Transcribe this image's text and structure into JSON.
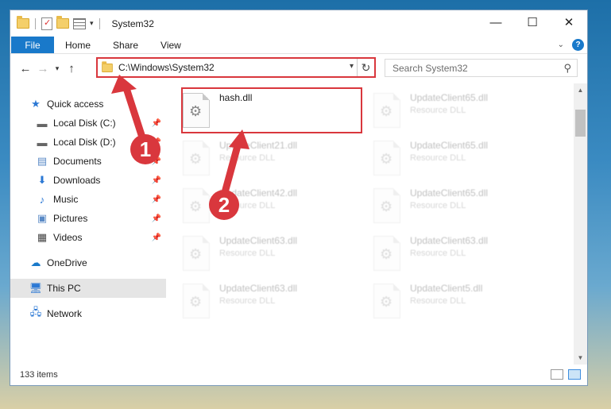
{
  "window": {
    "title": "System32",
    "controls": {
      "minimize": "—",
      "maximize": "☐",
      "close": "✕"
    }
  },
  "ribbon": {
    "file_tab": "File",
    "tabs": [
      "Home",
      "Share",
      "View"
    ]
  },
  "address": {
    "path": "C:\\Windows\\System32"
  },
  "search": {
    "placeholder": "Search System32"
  },
  "sidebar": {
    "quick_access": "Quick access",
    "pinned": [
      {
        "label": "Local Disk (C:)",
        "icon": "drive-icon"
      },
      {
        "label": "Local Disk (D:)",
        "icon": "drive-icon"
      },
      {
        "label": "Documents",
        "icon": "documents-icon"
      },
      {
        "label": "Downloads",
        "icon": "downloads-icon"
      },
      {
        "label": "Music",
        "icon": "music-icon"
      },
      {
        "label": "Pictures",
        "icon": "pictures-icon"
      },
      {
        "label": "Videos",
        "icon": "videos-icon"
      }
    ],
    "onedrive": "OneDrive",
    "this_pc": "This PC",
    "network": "Network"
  },
  "files": [
    {
      "name": "hash.dll",
      "type": "",
      "highlighted": true
    },
    {
      "name": "UpdateClient65.dll",
      "type": "Resource DLL"
    },
    {
      "name": "UpdateClient21.dll",
      "type": "Resource DLL"
    },
    {
      "name": "UpdateClient65.dll",
      "type": "Resource DLL"
    },
    {
      "name": "UpdateClient42.dll",
      "type": "Resource DLL"
    },
    {
      "name": "UpdateClient65.dll",
      "type": "Resource DLL"
    },
    {
      "name": "UpdateClient63.dll",
      "type": "Resource DLL"
    },
    {
      "name": "UpdateClient63.dll",
      "type": "Resource DLL"
    },
    {
      "name": "UpdateClient63.dll",
      "type": "Resource DLL"
    },
    {
      "name": "UpdateClient5.dll",
      "type": "Resource DLL"
    }
  ],
  "status": {
    "item_count": "133 items"
  },
  "callouts": {
    "step1": "1",
    "step2": "2"
  },
  "colors": {
    "accent": "#1979ca",
    "highlight_red": "#d9373d"
  }
}
